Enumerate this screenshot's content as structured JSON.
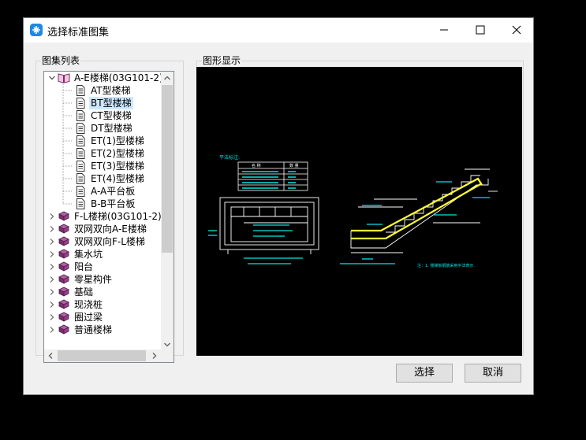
{
  "window": {
    "title": "选择标准图集",
    "controls": {
      "minimize": "minimize-icon",
      "maximize": "maximize-icon",
      "close": "close-icon"
    }
  },
  "list_panel": {
    "label": "图集列表"
  },
  "preview_panel": {
    "label": "图形显示"
  },
  "tree": {
    "items": [
      {
        "label": "A-E楼梯(03G101-2)",
        "kind": "book-open",
        "level": 0,
        "expanded": true
      },
      {
        "label": "AT型楼梯",
        "kind": "page",
        "level": 1
      },
      {
        "label": "BT型楼梯",
        "kind": "page",
        "level": 1,
        "selected": true
      },
      {
        "label": "CT型楼梯",
        "kind": "page",
        "level": 1
      },
      {
        "label": "DT型楼梯",
        "kind": "page",
        "level": 1
      },
      {
        "label": "ET(1)型楼梯",
        "kind": "page",
        "level": 1
      },
      {
        "label": "ET(2)型楼梯",
        "kind": "page",
        "level": 1
      },
      {
        "label": "ET(3)型楼梯",
        "kind": "page",
        "level": 1
      },
      {
        "label": "ET(4)型楼梯",
        "kind": "page",
        "level": 1
      },
      {
        "label": "A-A平台板",
        "kind": "page",
        "level": 1
      },
      {
        "label": "B-B平台板",
        "kind": "page",
        "level": 1
      },
      {
        "label": "F-L楼梯(03G101-2)",
        "kind": "book",
        "level": 0
      },
      {
        "label": "双网双向A-E楼梯",
        "kind": "book",
        "level": 0
      },
      {
        "label": "双网双向F-L楼梯",
        "kind": "book",
        "level": 0
      },
      {
        "label": "集水坑",
        "kind": "book",
        "level": 0
      },
      {
        "label": "阳台",
        "kind": "book",
        "level": 0
      },
      {
        "label": "零星构件",
        "kind": "book",
        "level": 0
      },
      {
        "label": "基础",
        "kind": "book",
        "level": 0
      },
      {
        "label": "现浇桩",
        "kind": "book",
        "level": 0
      },
      {
        "label": "圈过梁",
        "kind": "book",
        "level": 0
      },
      {
        "label": "普通楼梯",
        "kind": "book",
        "level": 0
      }
    ]
  },
  "preview": {
    "table_header": [
      "名 称",
      "数 量"
    ],
    "plan_label": "平法标注:",
    "note": "注：1. 楼梯板钢筋采用平法表示."
  },
  "buttons": {
    "select": "选择",
    "cancel": "取消"
  },
  "colors": {
    "accent": "#1e88e5",
    "selection": "#cce8ff",
    "cad_cyan": "#00e5e5",
    "cad_yellow": "#ffff33"
  }
}
